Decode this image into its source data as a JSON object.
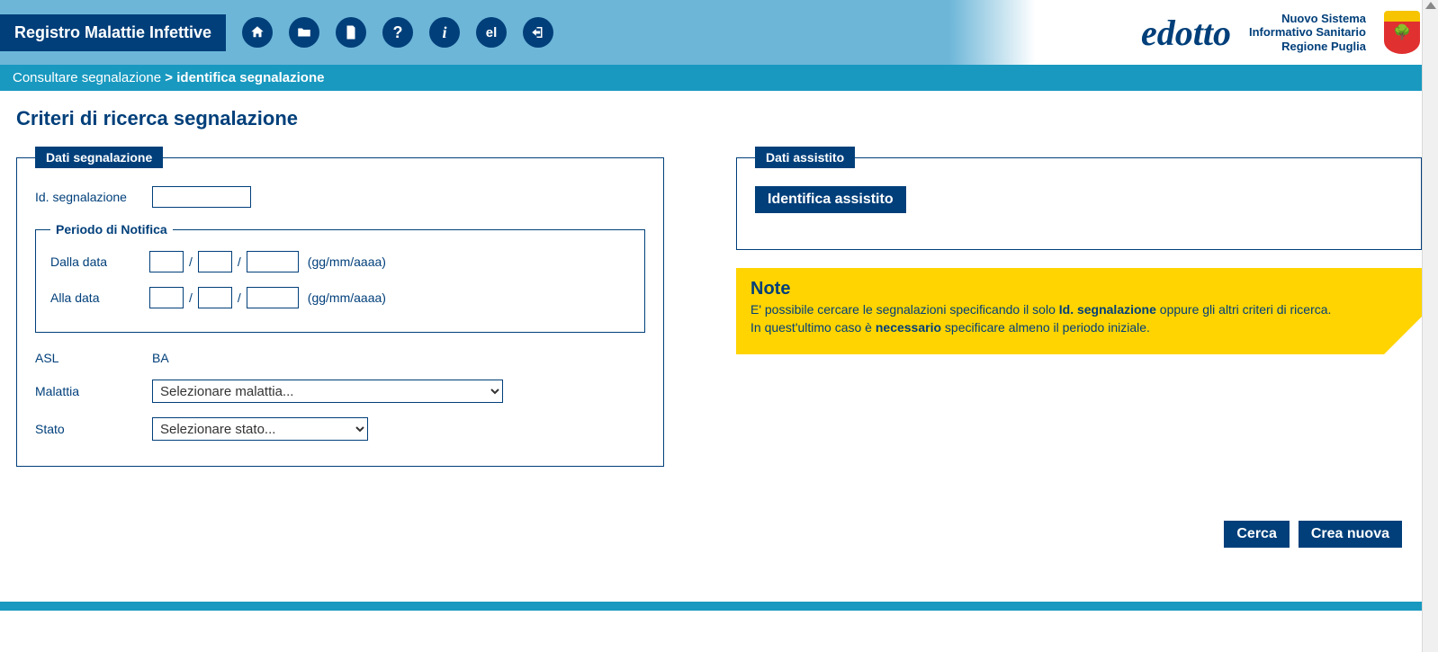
{
  "header": {
    "app_title": "Registro Malattie Infettive",
    "logo_text": "edotto",
    "sis_line1": "Nuovo Sistema",
    "sis_line2": "Informativo Sanitario",
    "sis_line3": "Regione Puglia"
  },
  "breadcrumb": {
    "step1": "Consultare segnalazione",
    "sep": ">",
    "step2": "identifica segnalazione"
  },
  "page_title": "Criteri di ricerca segnalazione",
  "fieldset_segnalazione": {
    "legend": "Dati segnalazione",
    "id_label": "Id. segnalazione",
    "periodo_legend": "Periodo di Notifica",
    "dalla_label": "Dalla data",
    "alla_label": "Alla data",
    "date_hint": "(gg/mm/aaaa)",
    "asl_label": "ASL",
    "asl_value": "BA",
    "malattia_label": "Malattia",
    "malattia_placeholder": "Selezionare malattia...",
    "stato_label": "Stato",
    "stato_placeholder": "Selezionare stato..."
  },
  "fieldset_assistito": {
    "legend": "Dati assistito",
    "identify_button": "Identifica assistito"
  },
  "note": {
    "title": "Note",
    "line1a": "E' possibile cercare le segnalazioni specificando il solo ",
    "line1b": "Id. segnalazione",
    "line1c": " oppure gli altri criteri di ricerca.",
    "line2a": "In quest'ultimo caso è ",
    "line2b": "necessario",
    "line2c": " specificare almeno il periodo iniziale."
  },
  "actions": {
    "search": "Cerca",
    "create": "Crea nuova"
  }
}
